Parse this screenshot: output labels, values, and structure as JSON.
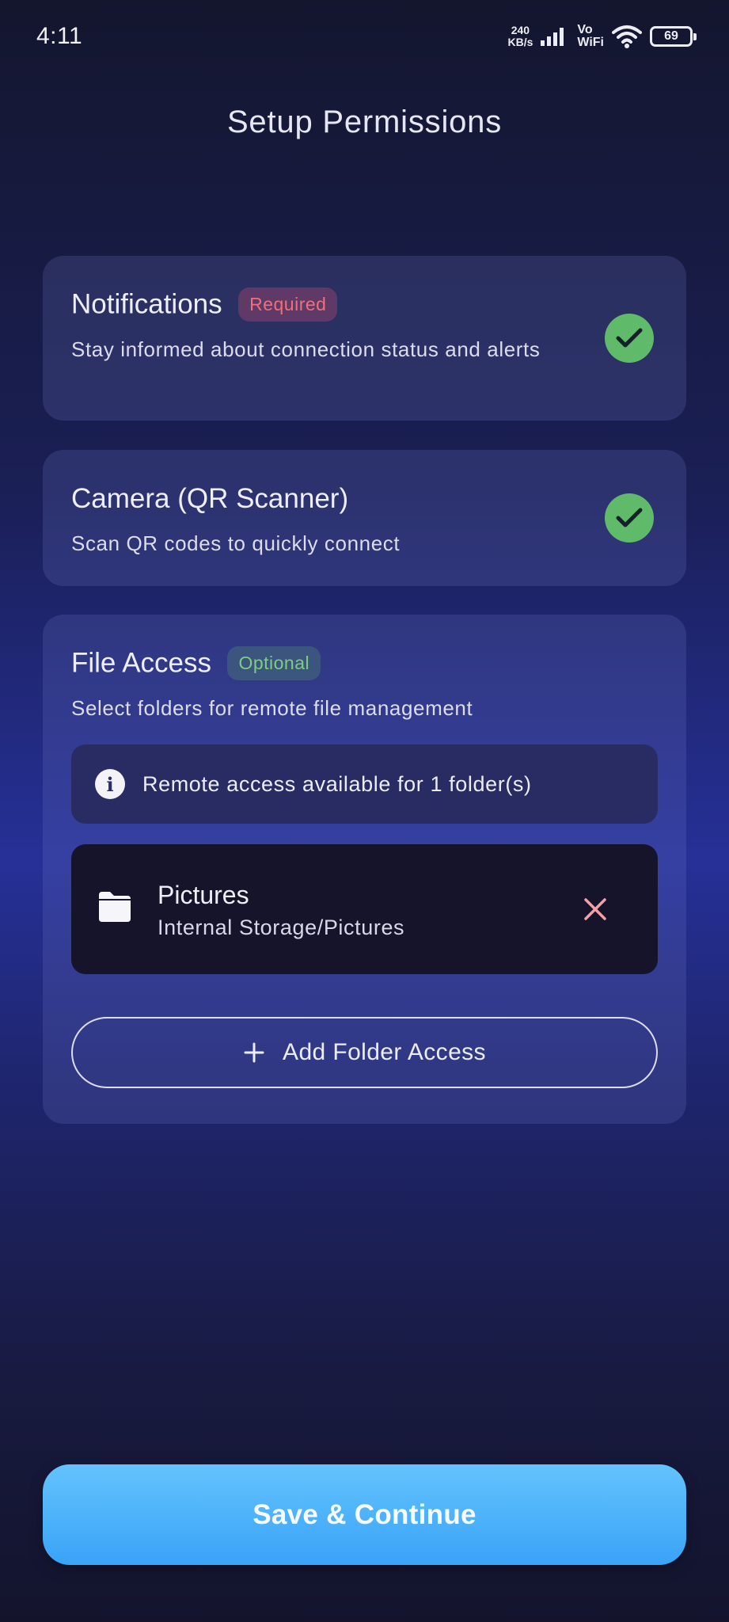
{
  "status_bar": {
    "time": "4:11",
    "speed_value": "240",
    "speed_unit": "KB/s",
    "vowifi_top": "Vo",
    "vowifi_bottom": "WiFi",
    "battery": "69"
  },
  "header": {
    "title": "Setup Permissions"
  },
  "notifications": {
    "title": "Notifications",
    "badge": "Required",
    "description": "Stay informed about connection status and alerts",
    "status_icon": "check-icon",
    "status_color": "#5fbb69"
  },
  "camera": {
    "title": "Camera (QR Scanner)",
    "description": "Scan QR codes to quickly connect",
    "status_icon": "check-icon",
    "status_color": "#5fbb69"
  },
  "file_access": {
    "title": "File Access",
    "badge": "Optional",
    "description": "Select folders for remote file management",
    "info": "Remote access available for 1 folder(s)",
    "folders": [
      {
        "name": "Pictures",
        "path": "Internal Storage/Pictures"
      }
    ],
    "add_button": "Add Folder Access"
  },
  "footer": {
    "save_button": "Save & Continue"
  },
  "colors": {
    "accent": "#3aa3f7",
    "required": "#ef6f7c",
    "optional": "#7cce7f",
    "remove": "#f4a0a4"
  }
}
